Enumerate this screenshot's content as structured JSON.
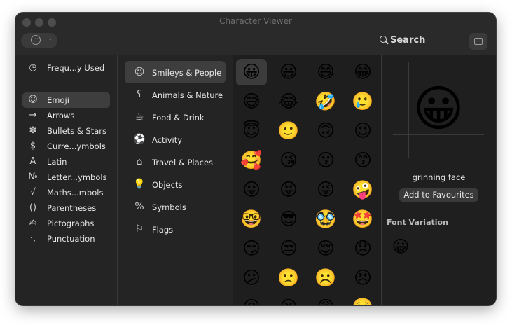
{
  "window": {
    "title": "Character Viewer"
  },
  "toolbar": {
    "action_dots": "···",
    "action_chevron": "⌄",
    "search_label": "Search"
  },
  "categories": [
    {
      "label": "Frequ...y Used",
      "icon": "clock-icon",
      "glyph": "◷"
    },
    {
      "label": "Emoji",
      "icon": "smiley-icon",
      "glyph": "☺",
      "selected": true
    },
    {
      "label": "Arrows",
      "icon": "arrow-icon",
      "glyph": "→"
    },
    {
      "label": "Bullets & Stars",
      "icon": "asterisk-icon",
      "glyph": "✻"
    },
    {
      "label": "Curre...ymbols",
      "icon": "dollar-icon",
      "glyph": "$"
    },
    {
      "label": "Latin",
      "icon": "letter-a-icon",
      "glyph": "A"
    },
    {
      "label": "Letter...ymbols",
      "icon": "numero-icon",
      "glyph": "№"
    },
    {
      "label": "Maths...mbols",
      "icon": "square-root-icon",
      "glyph": "√"
    },
    {
      "label": "Parentheses",
      "icon": "parentheses-icon",
      "glyph": "()"
    },
    {
      "label": "Pictographs",
      "icon": "pictograph-icon",
      "glyph": "✍"
    },
    {
      "label": "Punctuation",
      "icon": "punctuation-icon",
      "glyph": "·,"
    }
  ],
  "groups": [
    {
      "label": "Smileys & People",
      "icon": "smiley-icon",
      "glyph": "☺",
      "selected": true
    },
    {
      "label": "Animals & Nature",
      "icon": "bear-icon",
      "glyph": "ʕ"
    },
    {
      "label": "Food & Drink",
      "icon": "cup-icon",
      "glyph": "☕"
    },
    {
      "label": "Activity",
      "icon": "ball-icon",
      "glyph": "⚽"
    },
    {
      "label": "Travel & Places",
      "icon": "building-icon",
      "glyph": "⌂"
    },
    {
      "label": "Objects",
      "icon": "bulb-icon",
      "glyph": "💡"
    },
    {
      "label": "Symbols",
      "icon": "symbols-icon",
      "glyph": "%"
    },
    {
      "label": "Flags",
      "icon": "flag-icon",
      "glyph": "⚐"
    }
  ],
  "emoji_grid": [
    [
      "😀",
      "😃",
      "😄",
      "😁"
    ],
    [
      "😅",
      "😂",
      "🤣",
      "🥲"
    ],
    [
      "😇",
      "🙂",
      "🙃",
      "😉"
    ],
    [
      "🥰",
      "😘",
      "😗",
      "😙"
    ],
    [
      "😛",
      "😝",
      "😜",
      "🤪"
    ],
    [
      "🤓",
      "😎",
      "🥸",
      "🤩"
    ],
    [
      "😏",
      "😒",
      "😌",
      "😞"
    ],
    [
      "😕",
      "🙁",
      "☹️",
      "😣"
    ],
    [
      "😖",
      "😫",
      "😩",
      "🥺"
    ]
  ],
  "detail": {
    "glyph": "😀",
    "name": "grinning face",
    "add_button": "Add to Favourites",
    "font_variation_heading": "Font Variation",
    "variants": [
      "😀"
    ]
  }
}
